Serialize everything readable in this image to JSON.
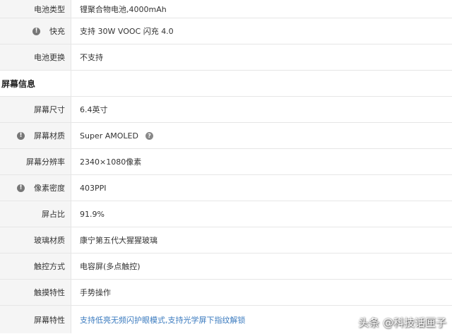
{
  "rows": [
    {
      "label": "电池类型",
      "value": "锂聚合物电池,4000mAh"
    },
    {
      "label": "快充",
      "value": "支持 30W VOOC 闪充 4.0"
    },
    {
      "label": "电池更换",
      "value": "不支持"
    },
    {
      "section": "屏幕信息"
    },
    {
      "label": "屏幕尺寸",
      "value": "6.4英寸"
    },
    {
      "label": "屏幕材质",
      "value": "Super AMOLED"
    },
    {
      "label": "屏幕分辨率",
      "value": "2340×1080像素"
    },
    {
      "label": "像素密度",
      "value": "403PPI"
    },
    {
      "label": "屏占比",
      "value": "91.9%"
    },
    {
      "label": "玻璃材质",
      "value": "康宁第五代大猩猩玻璃"
    },
    {
      "label": "触控方式",
      "value": "电容屏(多点触控)"
    },
    {
      "label": "触摸特性",
      "value": "手势操作"
    },
    {
      "label": "屏幕特性",
      "value": "支持低亮无频闪护眼模式,支持光学屏下指纹解锁"
    }
  ],
  "icons": {
    "warning_glyph": "!",
    "help_glyph": "?"
  },
  "watermark": "头条 @科技话匣子",
  "colors": {
    "label_bg": "#f5f5f5",
    "border": "#e6e6e6",
    "link": "#3b7bbf",
    "icon": "#777777"
  }
}
